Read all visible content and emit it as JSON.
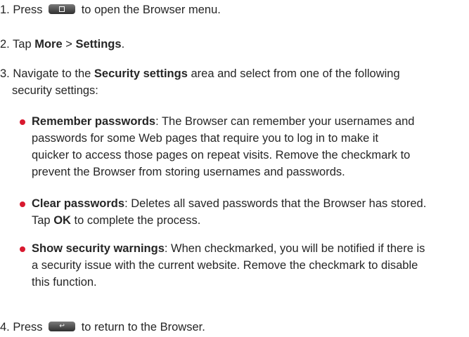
{
  "steps": {
    "s1": {
      "a": "1. Press",
      "b": "to open the Browser menu."
    },
    "s2": {
      "a": "2. Tap ",
      "b": "More",
      "c": " > ",
      "d": "Settings",
      "e": "."
    },
    "s3": {
      "a": "3. Navigate to the ",
      "b": "Security settings",
      "c": " area and select from one of the following",
      "d": "security settings:"
    },
    "s4": {
      "a": "4. Press",
      "b": "to return to the Browser."
    }
  },
  "bullets": {
    "remember": {
      "term": "Remember passwords",
      "l1": ": The Browser can remember your usernames and",
      "l2": "passwords for some Web pages that require you to log in to make it",
      "l3": "quicker to access those pages on repeat visits. Remove the checkmark to",
      "l4": "prevent the Browser from storing usernames and passwords."
    },
    "clear": {
      "term": "Clear passwords",
      "l1": ": Deletes all saved passwords that the Browser has stored.",
      "l2a": "Tap ",
      "l2b": "OK",
      "l2c": " to complete the process."
    },
    "warnings": {
      "term": "Show security warnings",
      "l1": ": When checkmarked, you will be notified if there is",
      "l2": "a security issue with the current website. Remove the checkmark to disable",
      "l3": "this function."
    }
  },
  "icons": {
    "menu_key": "menu-key-icon",
    "back_key": "back-key-icon"
  },
  "colors": {
    "bullet": "#d8192f",
    "text": "#262626"
  }
}
